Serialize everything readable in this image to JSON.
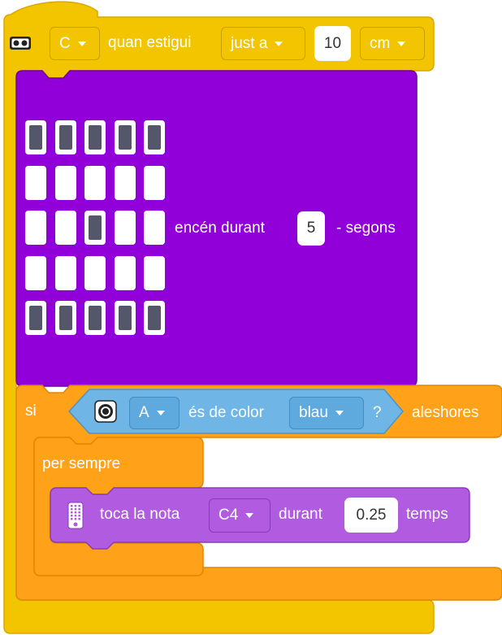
{
  "wait_block": {
    "port_value": "C",
    "label": "quan estigui",
    "comparison": "just a",
    "distance": "10",
    "unit": "cm",
    "icon": "distance-sensor-icon"
  },
  "light_block": {
    "matrix": [
      [
        1,
        1,
        1,
        1,
        1
      ],
      [
        0,
        0,
        0,
        0,
        0
      ],
      [
        0,
        0,
        1,
        0,
        0
      ],
      [
        0,
        0,
        0,
        0,
        0
      ],
      [
        1,
        1,
        1,
        1,
        1
      ]
    ],
    "label_on": "encén durant",
    "seconds": "5",
    "label_seconds": "- segons"
  },
  "if_block": {
    "keyword_if": "si",
    "port_value": "A",
    "label_color": "és de color",
    "color_value": "blau",
    "question": "?",
    "keyword_then": "aleshores",
    "icon": "color-sensor-icon"
  },
  "forever_block": {
    "label": "per sempre"
  },
  "sound_block": {
    "label_play": "toca la nota",
    "note": "C4",
    "label_for": "durant",
    "beats": "0.25",
    "label_beats": "temps",
    "icon": "hub-speaker-icon"
  },
  "colors": {
    "control_yellow": "#f2c500",
    "control_yellow_dark": "#d9a800",
    "light_purple": "#9200d9",
    "light_purple_dark": "#6e00a6",
    "event_orange": "#ffa21a",
    "event_orange_dark": "#e08600",
    "sound_violet": "#b05be0",
    "sound_violet_dark": "#8a3bbd"
  }
}
